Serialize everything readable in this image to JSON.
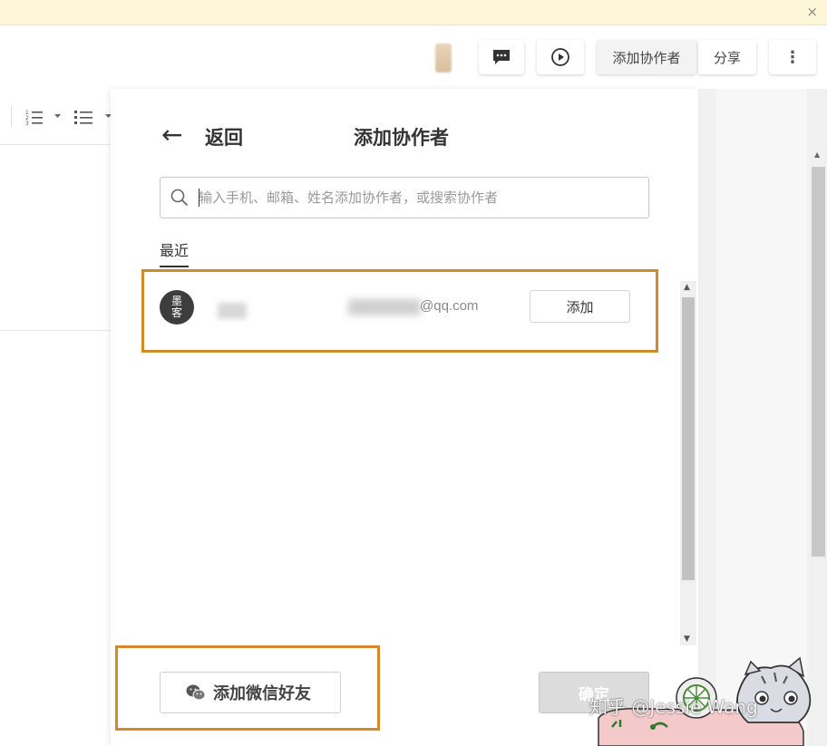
{
  "notice_bar": {
    "close_glyph": "×"
  },
  "header": {
    "comment_icon": "comment-icon",
    "present_icon": "play-icon",
    "add_collaborator_label": "添加协作者",
    "share_label": "分享",
    "more_glyph": "⋮"
  },
  "toolbar": {
    "ordered_list_icon": "ordered-list-icon",
    "bullet_list_icon": "bullet-list-icon"
  },
  "panel": {
    "back_glyph": "←",
    "back_label": "返回",
    "title": "添加协作者",
    "search_placeholder": "输入手机、邮箱、姓名添加协作者，或搜索协作者",
    "recent_tab": "最近",
    "recent_users": [
      {
        "avatar_text_top": "墨",
        "avatar_text_bottom": "客",
        "email_visible": "@qq.com",
        "add_label": "添加"
      }
    ],
    "wechat_button_label": "添加微信好友",
    "confirm_label": "确定"
  },
  "watermark": "知乎 @Jessie Wang",
  "colors": {
    "highlight_border": "#d28a2c",
    "notice_bg": "#fdf7d8",
    "confirm_disabled_bg": "#dcdcdc"
  }
}
